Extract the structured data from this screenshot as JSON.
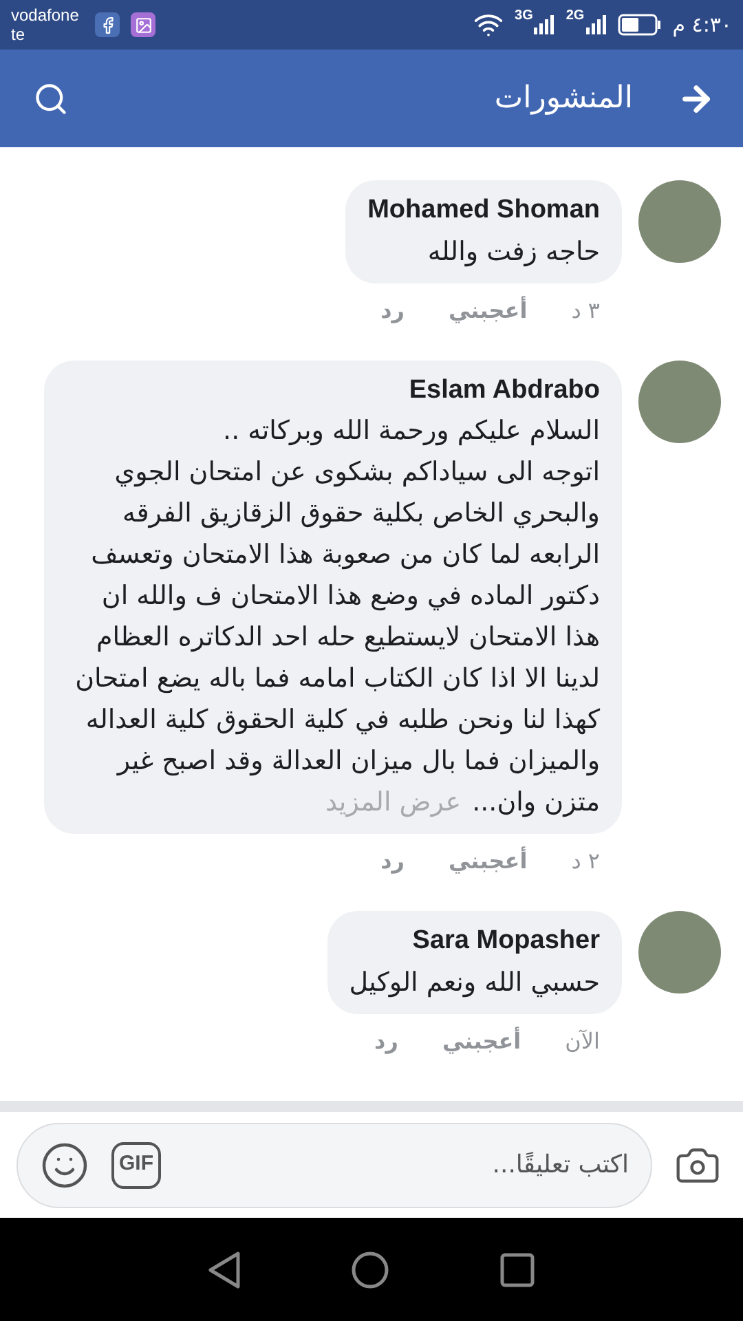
{
  "status_bar": {
    "carrier": [
      "vodafone",
      "te"
    ],
    "network_1": "3G",
    "network_2": "2G",
    "time": "٤:٣٠ م"
  },
  "header": {
    "title": "المنشورات"
  },
  "comments": [
    {
      "author": "Mohamed Shoman",
      "text": "حاجه زفت والله",
      "time": "٣ د",
      "like": "أعجبني",
      "reply": "رد"
    },
    {
      "author": "Eslam Abdrabo",
      "text": "السلام عليكم ورحمة الله وبركاته ..\nاتوجه الى سياداكم بشكوى عن امتحان الجوي والبحري الخاص بكلية حقوق الزقازيق الفرقه الرابعه لما كان من صعوبة هذا الامتحان وتعسف دكتور الماده في وضع هذا الامتحان ف والله ان هذا الامتحان لايستطيع حله احد الدكاتره العظام لدينا الا اذا كان الكتاب امامه فما باله يضع امتحان كهذا لنا ونحن طلبه في كلية الحقوق كلية العداله والميزان فما بال ميزان العدالة وقد اصبح غير متزن وان...",
      "see_more": "عرض المزيد",
      "time": "٢ د",
      "like": "أعجبني",
      "reply": "رد"
    },
    {
      "author": "Sara Mopasher",
      "text": "حسبي الله ونعم الوكيل",
      "time": "الآن",
      "like": "أعجبني",
      "reply": "رد"
    }
  ],
  "composer": {
    "placeholder": "اكتب تعليقًا...",
    "gif": "GIF"
  }
}
